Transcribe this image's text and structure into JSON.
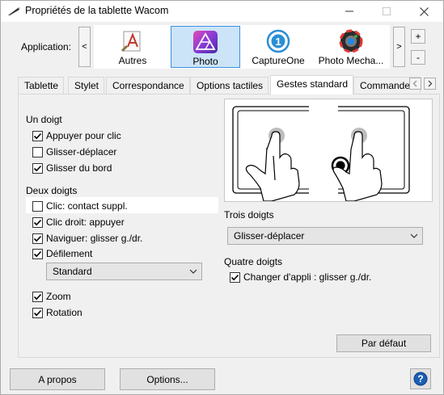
{
  "window": {
    "title": "Propriétés de la tablette Wacom"
  },
  "appbar": {
    "label": "Application:",
    "left_arrow": "<",
    "right_arrow": ">",
    "plus": "+",
    "minus": "-",
    "apps": [
      {
        "name": "Autres",
        "icon": "generic-app-icon",
        "selected": false
      },
      {
        "name": "Photo",
        "icon": "affinity-photo-icon",
        "selected": true
      },
      {
        "name": "CaptureOne",
        "icon": "captureone-icon",
        "selected": false
      },
      {
        "name": "Photo Mecha...",
        "icon": "photo-mechanic-icon",
        "selected": false
      }
    ]
  },
  "tabs": [
    "Tablette",
    "Stylet",
    "Correspondance",
    "Options tactiles",
    "Gestes standard",
    "Commande"
  ],
  "active_tab": "Gestes standard",
  "one_finger": {
    "header": "Un doigt",
    "items": [
      {
        "label": "Appuyer pour clic",
        "checked": true
      },
      {
        "label": "Glisser-déplacer",
        "checked": false
      },
      {
        "label": "Glisser du bord",
        "checked": true
      }
    ]
  },
  "two_fingers": {
    "header": "Deux doigts",
    "items": [
      {
        "label": "Clic: contact suppl.",
        "checked": false
      },
      {
        "label": "Clic droit: appuyer",
        "checked": true
      },
      {
        "label": "Naviguer: glisser g./dr.",
        "checked": true
      },
      {
        "label": "Défilement",
        "checked": true
      }
    ],
    "scroll_select": "Standard",
    "zoom": {
      "label": "Zoom",
      "checked": true
    },
    "rotation": {
      "label": "Rotation",
      "checked": true
    }
  },
  "three_fingers": {
    "header": "Trois doigts",
    "select": "Glisser-déplacer"
  },
  "four_fingers": {
    "header": "Quatre doigts",
    "item": {
      "label": "Changer d'appli : glisser g./dr.",
      "checked": true
    }
  },
  "buttons": {
    "default": "Par défaut",
    "about": "A propos",
    "options": "Options..."
  },
  "colors": {
    "selected_bg": "#cce4f7",
    "selected_border": "#3c8ee0",
    "help": "#1a5fb4"
  }
}
